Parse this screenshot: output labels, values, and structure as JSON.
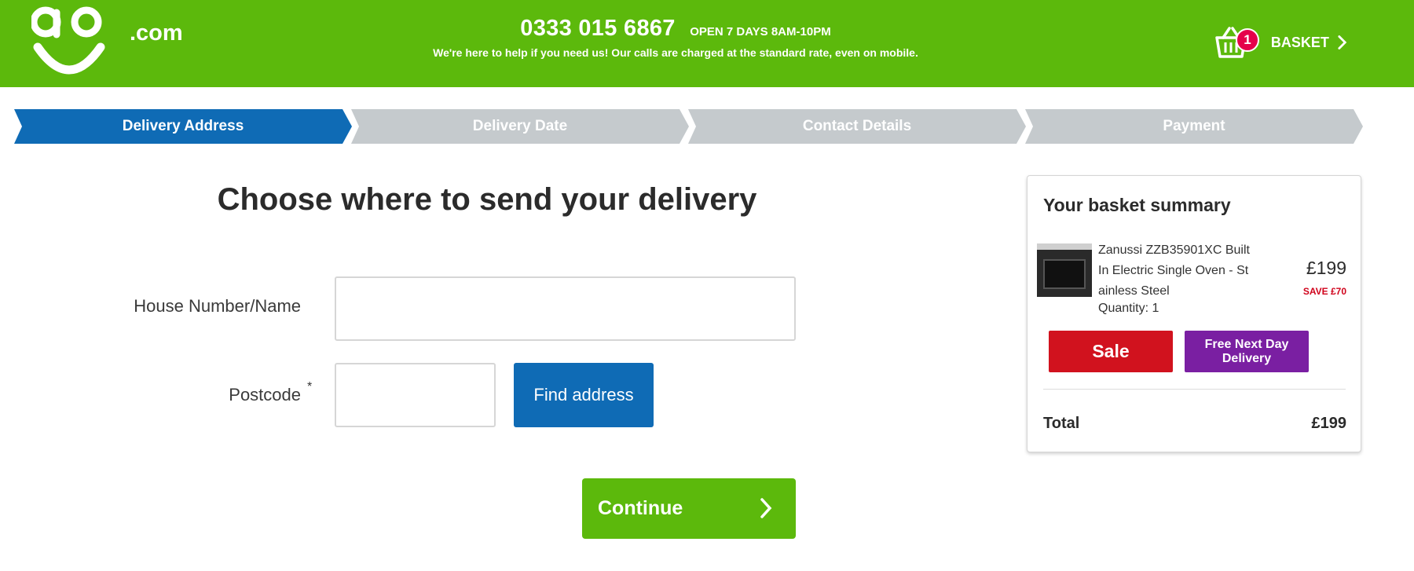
{
  "header": {
    "logo_suffix": ".com",
    "phone": "0333 015 6867",
    "hours": "OPEN 7 DAYS 8AM-10PM",
    "help_text": "We're here to help if you need us! Our calls are charged at the standard rate, even on mobile.",
    "basket_label": "BASKET",
    "basket_count": "1",
    "brand_color": "#5cb90c"
  },
  "steps": [
    {
      "label": "Delivery Address",
      "active": true
    },
    {
      "label": "Delivery Date",
      "active": false
    },
    {
      "label": "Contact Details",
      "active": false
    },
    {
      "label": "Payment",
      "active": false
    }
  ],
  "form": {
    "title": "Choose where to send your delivery",
    "house_label": "House Number/Name",
    "house_value": "",
    "postcode_label": "Postcode",
    "postcode_required_mark": "*",
    "postcode_value": "",
    "find_button": "Find address",
    "continue_button": "Continue"
  },
  "summary": {
    "title": "Your basket summary",
    "product_name": "Zanussi ZZB35901XC Built In Electric Single Oven - St ainless Steel",
    "quantity": "Quantity: 1",
    "price": "£199",
    "save": "SAVE £70",
    "badge_sale": "Sale",
    "badge_delivery": "Free Next Day Delivery",
    "total_label": "Total",
    "total_value": "£199",
    "colors": {
      "sale": "#d1121e",
      "delivery": "#7a1fa2",
      "step_active": "#0f6bb5",
      "step_inactive": "#c5cacd"
    }
  }
}
